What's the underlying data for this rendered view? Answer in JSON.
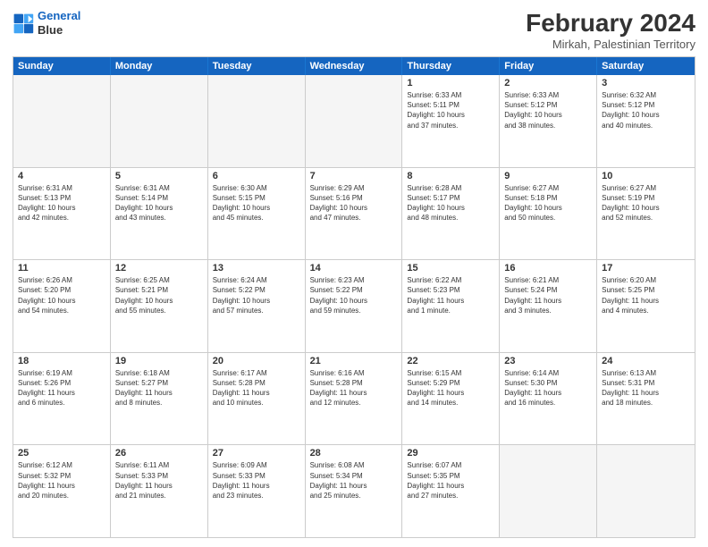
{
  "logo": {
    "line1": "General",
    "line2": "Blue"
  },
  "title": "February 2024",
  "subtitle": "Mirkah, Palestinian Territory",
  "header_days": [
    "Sunday",
    "Monday",
    "Tuesday",
    "Wednesday",
    "Thursday",
    "Friday",
    "Saturday"
  ],
  "rows": [
    [
      {
        "day": "",
        "text": "",
        "shaded": true
      },
      {
        "day": "",
        "text": "",
        "shaded": true
      },
      {
        "day": "",
        "text": "",
        "shaded": true
      },
      {
        "day": "",
        "text": "",
        "shaded": true
      },
      {
        "day": "1",
        "text": "Sunrise: 6:33 AM\nSunset: 5:11 PM\nDaylight: 10 hours\nand 37 minutes.",
        "shaded": false
      },
      {
        "day": "2",
        "text": "Sunrise: 6:33 AM\nSunset: 5:12 PM\nDaylight: 10 hours\nand 38 minutes.",
        "shaded": false
      },
      {
        "day": "3",
        "text": "Sunrise: 6:32 AM\nSunset: 5:12 PM\nDaylight: 10 hours\nand 40 minutes.",
        "shaded": false
      }
    ],
    [
      {
        "day": "4",
        "text": "Sunrise: 6:31 AM\nSunset: 5:13 PM\nDaylight: 10 hours\nand 42 minutes.",
        "shaded": false
      },
      {
        "day": "5",
        "text": "Sunrise: 6:31 AM\nSunset: 5:14 PM\nDaylight: 10 hours\nand 43 minutes.",
        "shaded": false
      },
      {
        "day": "6",
        "text": "Sunrise: 6:30 AM\nSunset: 5:15 PM\nDaylight: 10 hours\nand 45 minutes.",
        "shaded": false
      },
      {
        "day": "7",
        "text": "Sunrise: 6:29 AM\nSunset: 5:16 PM\nDaylight: 10 hours\nand 47 minutes.",
        "shaded": false
      },
      {
        "day": "8",
        "text": "Sunrise: 6:28 AM\nSunset: 5:17 PM\nDaylight: 10 hours\nand 48 minutes.",
        "shaded": false
      },
      {
        "day": "9",
        "text": "Sunrise: 6:27 AM\nSunset: 5:18 PM\nDaylight: 10 hours\nand 50 minutes.",
        "shaded": false
      },
      {
        "day": "10",
        "text": "Sunrise: 6:27 AM\nSunset: 5:19 PM\nDaylight: 10 hours\nand 52 minutes.",
        "shaded": false
      }
    ],
    [
      {
        "day": "11",
        "text": "Sunrise: 6:26 AM\nSunset: 5:20 PM\nDaylight: 10 hours\nand 54 minutes.",
        "shaded": false
      },
      {
        "day": "12",
        "text": "Sunrise: 6:25 AM\nSunset: 5:21 PM\nDaylight: 10 hours\nand 55 minutes.",
        "shaded": false
      },
      {
        "day": "13",
        "text": "Sunrise: 6:24 AM\nSunset: 5:22 PM\nDaylight: 10 hours\nand 57 minutes.",
        "shaded": false
      },
      {
        "day": "14",
        "text": "Sunrise: 6:23 AM\nSunset: 5:22 PM\nDaylight: 10 hours\nand 59 minutes.",
        "shaded": false
      },
      {
        "day": "15",
        "text": "Sunrise: 6:22 AM\nSunset: 5:23 PM\nDaylight: 11 hours\nand 1 minute.",
        "shaded": false
      },
      {
        "day": "16",
        "text": "Sunrise: 6:21 AM\nSunset: 5:24 PM\nDaylight: 11 hours\nand 3 minutes.",
        "shaded": false
      },
      {
        "day": "17",
        "text": "Sunrise: 6:20 AM\nSunset: 5:25 PM\nDaylight: 11 hours\nand 4 minutes.",
        "shaded": false
      }
    ],
    [
      {
        "day": "18",
        "text": "Sunrise: 6:19 AM\nSunset: 5:26 PM\nDaylight: 11 hours\nand 6 minutes.",
        "shaded": false
      },
      {
        "day": "19",
        "text": "Sunrise: 6:18 AM\nSunset: 5:27 PM\nDaylight: 11 hours\nand 8 minutes.",
        "shaded": false
      },
      {
        "day": "20",
        "text": "Sunrise: 6:17 AM\nSunset: 5:28 PM\nDaylight: 11 hours\nand 10 minutes.",
        "shaded": false
      },
      {
        "day": "21",
        "text": "Sunrise: 6:16 AM\nSunset: 5:28 PM\nDaylight: 11 hours\nand 12 minutes.",
        "shaded": false
      },
      {
        "day": "22",
        "text": "Sunrise: 6:15 AM\nSunset: 5:29 PM\nDaylight: 11 hours\nand 14 minutes.",
        "shaded": false
      },
      {
        "day": "23",
        "text": "Sunrise: 6:14 AM\nSunset: 5:30 PM\nDaylight: 11 hours\nand 16 minutes.",
        "shaded": false
      },
      {
        "day": "24",
        "text": "Sunrise: 6:13 AM\nSunset: 5:31 PM\nDaylight: 11 hours\nand 18 minutes.",
        "shaded": false
      }
    ],
    [
      {
        "day": "25",
        "text": "Sunrise: 6:12 AM\nSunset: 5:32 PM\nDaylight: 11 hours\nand 20 minutes.",
        "shaded": false
      },
      {
        "day": "26",
        "text": "Sunrise: 6:11 AM\nSunset: 5:33 PM\nDaylight: 11 hours\nand 21 minutes.",
        "shaded": false
      },
      {
        "day": "27",
        "text": "Sunrise: 6:09 AM\nSunset: 5:33 PM\nDaylight: 11 hours\nand 23 minutes.",
        "shaded": false
      },
      {
        "day": "28",
        "text": "Sunrise: 6:08 AM\nSunset: 5:34 PM\nDaylight: 11 hours\nand 25 minutes.",
        "shaded": false
      },
      {
        "day": "29",
        "text": "Sunrise: 6:07 AM\nSunset: 5:35 PM\nDaylight: 11 hours\nand 27 minutes.",
        "shaded": false
      },
      {
        "day": "",
        "text": "",
        "shaded": true
      },
      {
        "day": "",
        "text": "",
        "shaded": true
      }
    ]
  ]
}
